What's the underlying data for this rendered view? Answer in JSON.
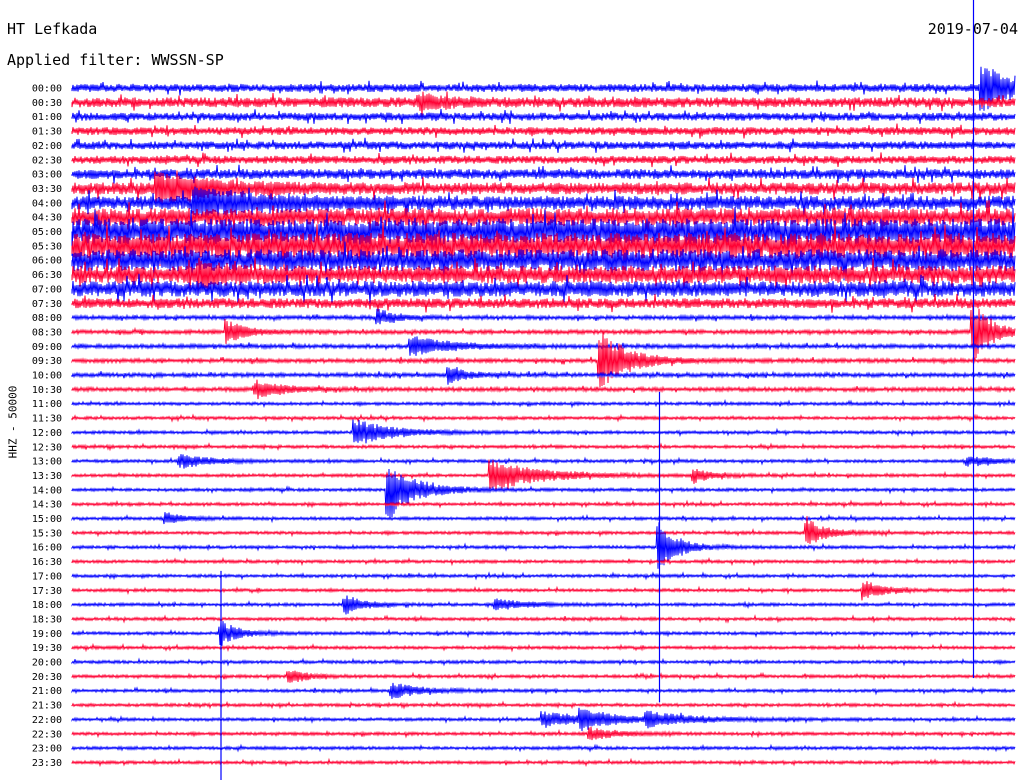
{
  "header": {
    "station": "HT Lefkada",
    "filter": "Applied filter: WWSSN-SP",
    "date": "2019-07-04"
  },
  "chart_data": {
    "type": "line",
    "title": "HT Lefkada",
    "ylabel": "HHZ - 50000",
    "colors": [
      "#0000ff",
      "#ff0033"
    ],
    "trace_labels": [
      "00:00",
      "00:30",
      "01:00",
      "01:30",
      "02:00",
      "02:30",
      "03:00",
      "03:30",
      "04:00",
      "04:30",
      "05:00",
      "05:30",
      "06:00",
      "06:30",
      "07:00",
      "07:30",
      "08:00",
      "08:30",
      "09:00",
      "09:30",
      "10:00",
      "10:30",
      "11:00",
      "11:30",
      "12:00",
      "12:30",
      "13:00",
      "13:30",
      "14:00",
      "14:30",
      "15:00",
      "15:30",
      "16:00",
      "16:30",
      "17:00",
      "17:30",
      "18:00",
      "18:30",
      "19:00",
      "19:30",
      "20:00",
      "20:30",
      "21:00",
      "21:30",
      "22:00",
      "22:30",
      "23:00",
      "23:30"
    ],
    "noise_level": [
      4,
      5,
      4,
      4,
      4,
      4,
      5,
      6,
      7,
      9,
      13,
      13,
      11,
      9,
      8,
      5,
      2,
      2,
      2,
      2,
      2,
      2,
      1.5,
      1.5,
      1.5,
      1.5,
      1.5,
      1.5,
      1.5,
      1.5,
      1.5,
      1.5,
      1.5,
      1.5,
      1.5,
      1.5,
      1.5,
      1.5,
      1.5,
      1.5,
      1.5,
      1.5,
      1.5,
      1.5,
      1.5,
      1.5,
      1.5,
      1.5
    ],
    "events": [
      {
        "trace": 0,
        "t": 0.965,
        "amp": 26,
        "dur": 0.025
      },
      {
        "trace": 1,
        "t": 0.37,
        "amp": 7,
        "dur": 0.03
      },
      {
        "trace": 7,
        "t": 0.09,
        "amp": 14,
        "dur": 0.06
      },
      {
        "trace": 8,
        "t": 0.13,
        "amp": 12,
        "dur": 0.08
      },
      {
        "trace": 13,
        "t": 0.135,
        "amp": 10,
        "dur": 0.03
      },
      {
        "trace": 16,
        "t": 0.325,
        "amp": 8,
        "dur": 0.02
      },
      {
        "trace": 17,
        "t": 0.165,
        "amp": 12,
        "dur": 0.02
      },
      {
        "trace": 17,
        "t": 0.956,
        "amp": 30,
        "dur": 0.02
      },
      {
        "trace": 18,
        "t": 0.36,
        "amp": 10,
        "dur": 0.04
      },
      {
        "trace": 19,
        "t": 0.56,
        "amp": 30,
        "dur": 0.03
      },
      {
        "trace": 20,
        "t": 0.4,
        "amp": 8,
        "dur": 0.02
      },
      {
        "trace": 21,
        "t": 0.195,
        "amp": 9,
        "dur": 0.03
      },
      {
        "trace": 24,
        "t": 0.3,
        "amp": 14,
        "dur": 0.04
      },
      {
        "trace": 26,
        "t": 0.115,
        "amp": 8,
        "dur": 0.03
      },
      {
        "trace": 26,
        "t": 0.95,
        "amp": 5,
        "dur": 0.03
      },
      {
        "trace": 27,
        "t": 0.445,
        "amp": 16,
        "dur": 0.05
      },
      {
        "trace": 27,
        "t": 0.66,
        "amp": 7,
        "dur": 0.02
      },
      {
        "trace": 28,
        "t": 0.335,
        "amp": 30,
        "dur": 0.03
      },
      {
        "trace": 30,
        "t": 0.1,
        "amp": 6,
        "dur": 0.02
      },
      {
        "trace": 31,
        "t": 0.78,
        "amp": 14,
        "dur": 0.02
      },
      {
        "trace": 32,
        "t": 0.623,
        "amp": 25,
        "dur": 0.02
      },
      {
        "trace": 35,
        "t": 0.84,
        "amp": 10,
        "dur": 0.02
      },
      {
        "trace": 36,
        "t": 0.29,
        "amp": 10,
        "dur": 0.02
      },
      {
        "trace": 36,
        "t": 0.45,
        "amp": 6,
        "dur": 0.03
      },
      {
        "trace": 38,
        "t": 0.158,
        "amp": 12,
        "dur": 0.02
      },
      {
        "trace": 41,
        "t": 0.23,
        "amp": 7,
        "dur": 0.02
      },
      {
        "trace": 42,
        "t": 0.34,
        "amp": 8,
        "dur": 0.03
      },
      {
        "trace": 44,
        "t": 0.5,
        "amp": 8,
        "dur": 0.05
      },
      {
        "trace": 44,
        "t": 0.54,
        "amp": 9,
        "dur": 0.03
      },
      {
        "trace": 44,
        "t": 0.61,
        "amp": 7,
        "dur": 0.05
      },
      {
        "trace": 45,
        "t": 0.55,
        "amp": 6,
        "dur": 0.03
      }
    ],
    "spikes": [
      {
        "trace": 24,
        "t": 0.623,
        "amp": 270
      },
      {
        "trace": 36,
        "t": 0.158,
        "amp": 225
      },
      {
        "trace": 0,
        "t": 0.956,
        "amp": 590
      }
    ]
  }
}
